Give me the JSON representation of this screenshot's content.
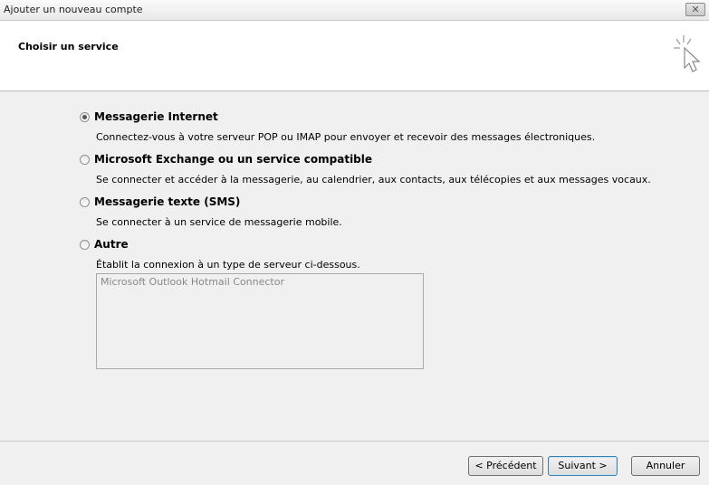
{
  "window": {
    "title": "Ajouter un nouveau compte",
    "close_icon": "close-icon"
  },
  "header": {
    "title": "Choisir un service",
    "icon": "wizard-cursor-icon"
  },
  "options": [
    {
      "label": "Messagerie Internet",
      "description": "Connectez-vous à votre serveur POP ou IMAP pour envoyer et recevoir des messages électroniques.",
      "selected": true
    },
    {
      "label": "Microsoft Exchange ou un service compatible",
      "description": "Se connecter et accéder à la messagerie, au calendrier, aux contacts, aux télécopies et aux messages vocaux.",
      "selected": false
    },
    {
      "label": "Messagerie texte (SMS)",
      "description": "Se connecter à un service de messagerie mobile.",
      "selected": false
    },
    {
      "label": "Autre",
      "description": "Établit la connexion à un type de serveur ci-dessous.",
      "selected": false
    }
  ],
  "other_list": {
    "items": [
      "Microsoft Outlook Hotmail Connector"
    ]
  },
  "buttons": {
    "previous": "< Précédent",
    "next": "Suivant >",
    "cancel": "Annuler"
  }
}
